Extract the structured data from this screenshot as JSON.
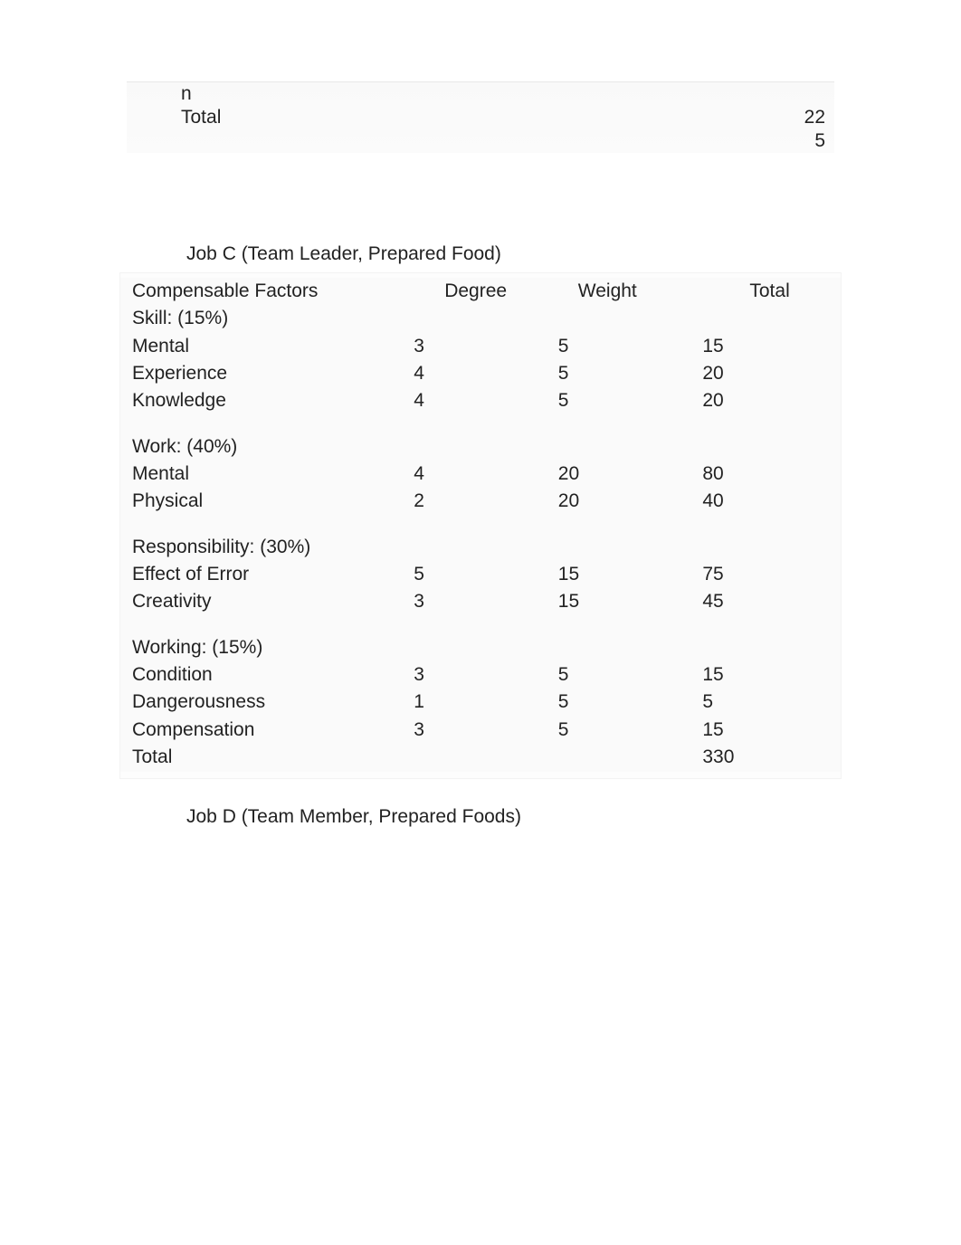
{
  "topFragment": {
    "rows": [
      {
        "factor": "n",
        "degree": "",
        "weight": "",
        "total": ""
      },
      {
        "factor": "Total",
        "degree": "",
        "weight": "",
        "total": "22"
      },
      {
        "factor": "",
        "degree": "",
        "weight": "",
        "total": "5"
      }
    ]
  },
  "jobC": {
    "title": "Job C (Team Leader, Prepared Food)",
    "headers": {
      "factor": "Compensable Factors",
      "degree": "Degree",
      "weight": "Weight",
      "total": "Total"
    },
    "groups": [
      {
        "heading": "Skill: (15%)",
        "rows": [
          {
            "factor": "Mental",
            "degree": "3",
            "weight": "5",
            "total": "15"
          },
          {
            "factor": "Experience",
            "degree": "4",
            "weight": "5",
            "total": "20"
          },
          {
            "factor": "Knowledge",
            "degree": "4",
            "weight": "5",
            "total": "20"
          }
        ]
      },
      {
        "heading": "Work: (40%)",
        "rows": [
          {
            "factor": "Mental",
            "degree": "4",
            "weight": "20",
            "total": "80"
          },
          {
            "factor": "Physical",
            "degree": "2",
            "weight": "20",
            "total": "40"
          }
        ]
      },
      {
        "heading": "Responsibility: (30%)",
        "rows": [
          {
            "factor": "Effect of Error",
            "degree": "5",
            "weight": "15",
            "total": "75"
          },
          {
            "factor": "Creativity",
            "degree": "3",
            "weight": "15",
            "total": "45"
          }
        ]
      },
      {
        "heading": "Working: (15%)",
        "rows": [
          {
            "factor": "Condition",
            "degree": "3",
            "weight": "5",
            "total": "15"
          },
          {
            "factor": "Dangerousness",
            "degree": "1",
            "weight": "5",
            "total": "5"
          },
          {
            "factor": "Compensation",
            "degree": "3",
            "weight": "5",
            "total": "15"
          }
        ]
      }
    ],
    "totalRow": {
      "factor": "Total",
      "degree": "",
      "weight": "",
      "total": "330"
    }
  },
  "jobD": {
    "title": "Job D (Team Member, Prepared Foods)"
  }
}
